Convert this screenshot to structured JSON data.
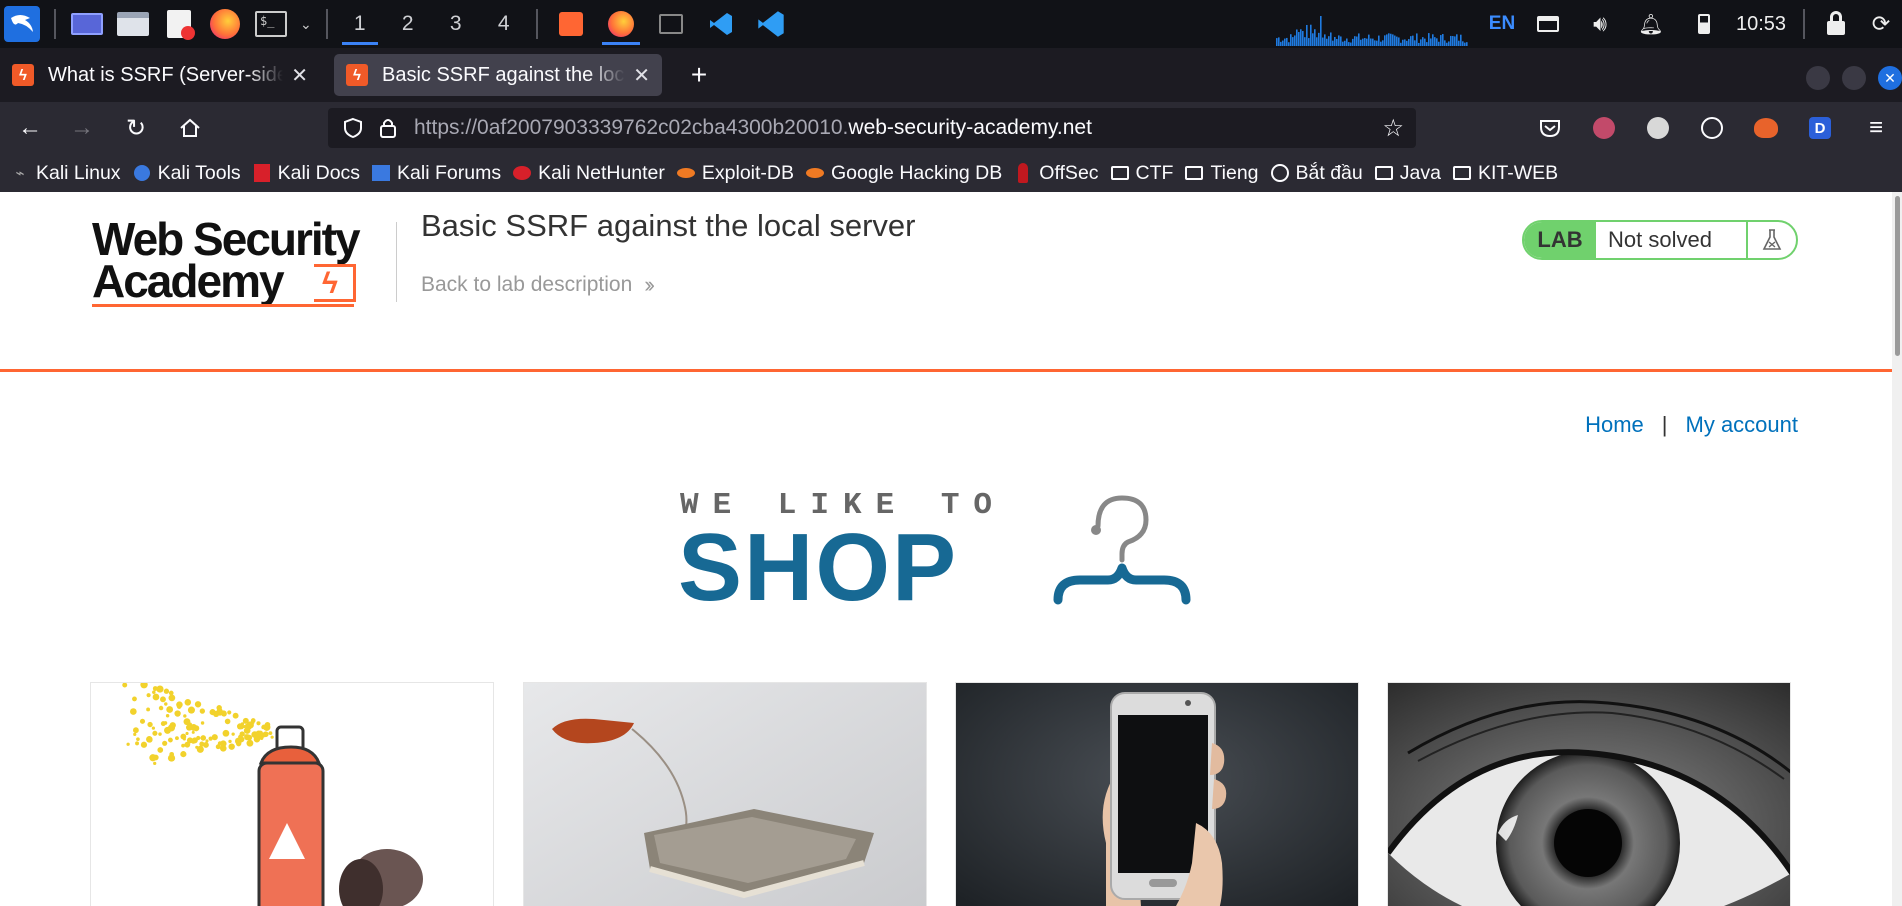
{
  "panel": {
    "workspaces": [
      "1",
      "2",
      "3",
      "4"
    ],
    "active_workspace": "1",
    "language": "EN",
    "clock": "10:53"
  },
  "browser": {
    "tabs": [
      {
        "title": "What is SSRF (Server-side request forgery)",
        "selected": false
      },
      {
        "title": "Basic SSRF against the local server",
        "selected": true
      }
    ],
    "new_tab_label": "+",
    "url_prefix": "https://0af2007903339762c02cba4300b20010.",
    "url_domain": "web-security-academy.net",
    "bookmarks": [
      {
        "label": "Kali Linux",
        "icon": "kali-dragon-icon"
      },
      {
        "label": "Kali Tools",
        "icon": "kali-tools-icon"
      },
      {
        "label": "Kali Docs",
        "icon": "kali-docs-icon"
      },
      {
        "label": "Kali Forums",
        "icon": "kali-forums-icon"
      },
      {
        "label": "Kali NetHunter",
        "icon": "nethunter-icon"
      },
      {
        "label": "Exploit-DB",
        "icon": "exploitdb-icon"
      },
      {
        "label": "Google Hacking DB",
        "icon": "ghdb-icon"
      },
      {
        "label": "OffSec",
        "icon": "offsec-icon"
      },
      {
        "label": "CTF",
        "icon": "folder-icon"
      },
      {
        "label": "Tieng",
        "icon": "folder-icon"
      },
      {
        "label": "Bắt đầu",
        "icon": "globe-icon"
      },
      {
        "label": "Java",
        "icon": "folder-icon"
      },
      {
        "label": "KIT-WEB",
        "icon": "folder-icon"
      }
    ],
    "overflow_label": "»"
  },
  "page": {
    "logo_line1": "Web Security",
    "logo_line2": "Academy",
    "lab_title": "Basic SSRF against the local server",
    "back_link": "Back to lab description",
    "lab_badge": "LAB",
    "lab_status": "Not solved",
    "nav_home": "Home",
    "nav_separator": "|",
    "nav_account": "My account",
    "shop_tagline": "WE LIKE TO",
    "shop_word": "SHOP",
    "products": [
      {
        "name": "product-spray-can",
        "icon": "spray-can-image"
      },
      {
        "name": "product-tea-bag",
        "icon": "tea-bag-image"
      },
      {
        "name": "product-smartphone",
        "icon": "smartphone-image"
      },
      {
        "name": "product-eye",
        "icon": "eye-image"
      }
    ],
    "colors": {
      "accent": "#ff6633",
      "link": "#0071bc",
      "shop_blue": "#176994",
      "lab_green": "#70d16d"
    }
  }
}
